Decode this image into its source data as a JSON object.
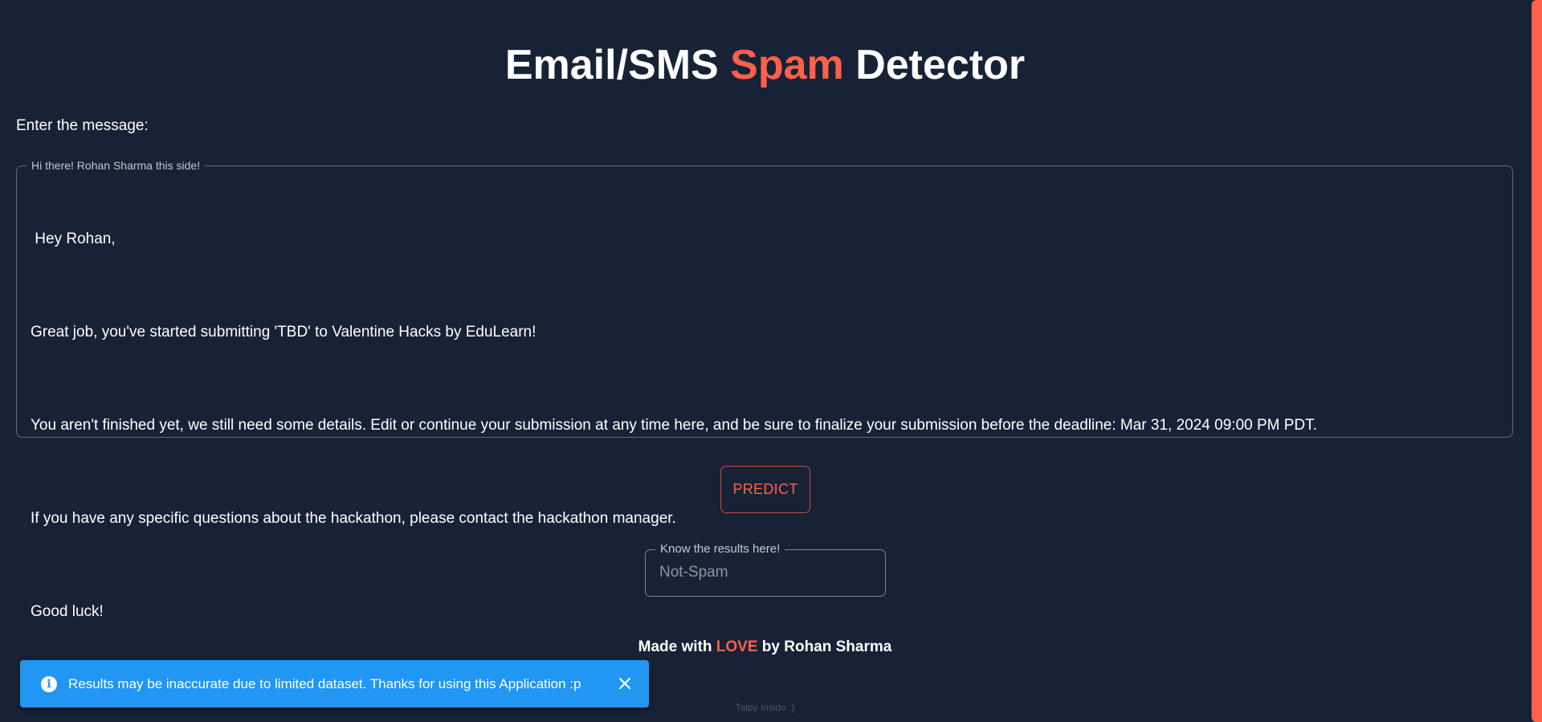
{
  "header": {
    "title_prefix": "Email/SMS ",
    "title_accent": "Spam",
    "title_suffix": " Detector"
  },
  "form": {
    "prompt_label": "Enter the message:",
    "message_legend": "Hi there! Rohan Sharma this side!",
    "message_lines": [
      " Hey Rohan,",
      "Great job, you've started submitting 'TBD' to Valentine Hacks by EduLearn!",
      "You aren't finished yet, we still need some details. Edit or continue your submission at any time here, and be sure to finalize your submission before the deadline: Mar 31, 2024 09:00 PM PDT.",
      "If you have any specific questions about the hackathon, please contact the hackathon manager.",
      "Good luck!"
    ],
    "predict_label": "PREDICT",
    "result_legend": "Know the results here!",
    "result_value": "Not-Spam"
  },
  "footer": {
    "prefix": "Made with ",
    "love": "LOVE",
    "suffix": " by Rohan Sharma",
    "taipy": "Taipy Inside :)"
  },
  "snackbar": {
    "icon": "info-icon",
    "message": "Results may be inaccurate due to limited dataset. Thanks for using this Application :p",
    "close_icon": "close-icon"
  },
  "colors": {
    "background": "#172236",
    "accent": "#ff6049",
    "snackbar": "#2196f3"
  }
}
